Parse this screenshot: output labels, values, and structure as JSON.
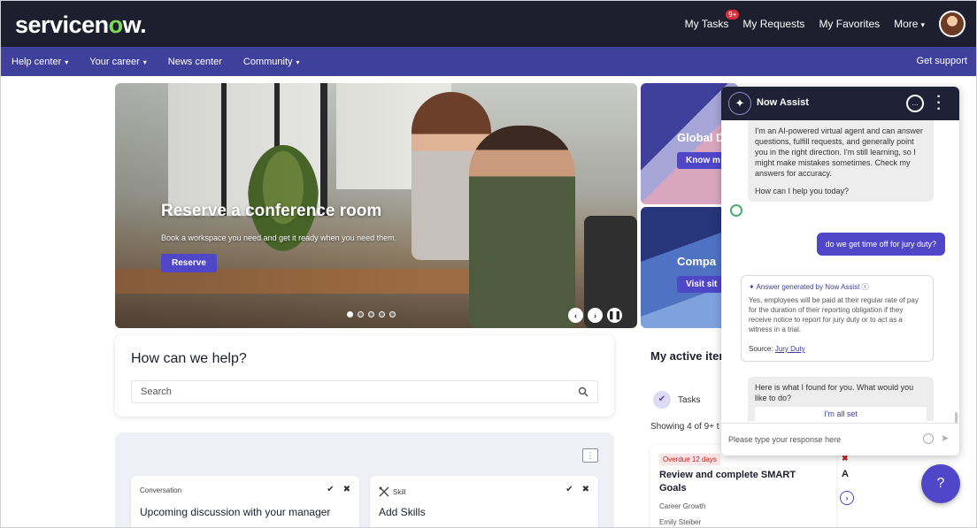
{
  "brand": {
    "logo_text_a": "servicen",
    "logo_text_o": "o",
    "logo_text_b": "w."
  },
  "topbar": {
    "my_tasks": "My Tasks",
    "my_tasks_badge": "9+",
    "my_requests": "My Requests",
    "my_favorites": "My Favorites",
    "more": "More",
    "more_caret": "▾"
  },
  "nav": {
    "items": [
      {
        "label": "Help center",
        "caret": "▾"
      },
      {
        "label": "Your career",
        "caret": "▾"
      },
      {
        "label": "News center",
        "caret": ""
      },
      {
        "label": "Community",
        "caret": "▾"
      }
    ],
    "get_support": "Get support"
  },
  "hero": {
    "title": "Reserve a conference room",
    "subtitle": "Book a workspace you need and get it ready when you need them.",
    "button": "Reserve",
    "prev": "‹",
    "next": "›",
    "pause": "❚❚"
  },
  "side_cards": [
    {
      "title": "Global D",
      "button": "Know m"
    },
    {
      "title": "Compa",
      "button": "Visit sit"
    }
  ],
  "help": {
    "title": "How can we help?",
    "search_placeholder": "Search"
  },
  "lower_panel": {
    "toggle": "⋮",
    "todos": [
      {
        "type": "Conversation",
        "title": "Upcoming discussion with your manager",
        "check": "✔",
        "close": "✖"
      },
      {
        "type": "Skill",
        "title": "Add Skills",
        "check": "✔",
        "close": "✖"
      }
    ]
  },
  "active_items": {
    "title": "My active iter",
    "tasks_label": "Tasks",
    "showing": "Showing 4 of 9+ t",
    "task": {
      "badge": "Overdue 12 days",
      "title": "Review and complete SMART Goals",
      "sub1": "Career Growth",
      "sub2": "Emily Steiber"
    },
    "peek_x": "✖",
    "peek_letter": "A",
    "peek_arrow": "›"
  },
  "chat": {
    "title": "Now Assist",
    "intro": "I'm an AI-powered virtual agent and can answer questions, fulfill requests, and generally point you in the right direction. I'm still learning, so I might make mistakes sometimes. Check my answers for accuracy.",
    "ask": "How can I help you today?",
    "user_message": "do we get time off for jury duty?",
    "answer_header": "✦ Answer generated by Now Assist ⓘ",
    "answer_text": "Yes, employees will be paid at their regular rate of pay for the duration of their reporting obligation if they receive notice to report for jury duty or to act as a witness in a trial.",
    "source_label": "Source:",
    "source_link": "Jury Duty",
    "found_text": "Here is what I found for you. What would you like to do?",
    "all_set": "I'm all set",
    "input_placeholder": "Please type your response here",
    "send": "➤"
  },
  "fab": {
    "icon": "?"
  },
  "colors": {
    "topbar": "#1d1f2e",
    "navbar": "#3f3f9c",
    "accent": "#4f46c8",
    "logo_o": "#7ed957"
  }
}
